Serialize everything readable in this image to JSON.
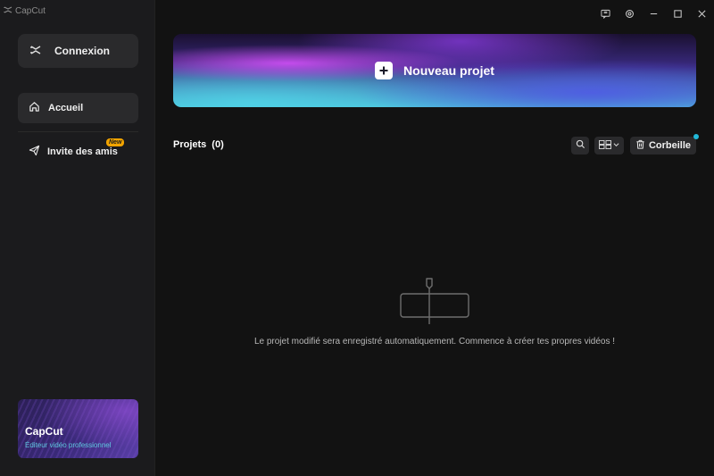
{
  "app": {
    "title": "CapCut"
  },
  "sidebar": {
    "login_label": "Connexion",
    "items": [
      {
        "label": "Accueil",
        "icon": "home-icon"
      },
      {
        "label": "Invite des amis",
        "icon": "send-icon",
        "badge": "New"
      }
    ],
    "promo": {
      "title": "CapCut",
      "subtitle": "Éditeur vidéo professionnel"
    }
  },
  "titlebar": {
    "icons": [
      "feedback-icon",
      "settings-icon",
      "minimize-icon",
      "maximize-icon",
      "close-icon"
    ]
  },
  "main": {
    "new_project_label": "Nouveau projet",
    "projects_label": "Projets",
    "projects_count": "(0)",
    "trash_label": "Corbeille",
    "empty_message": "Le projet modifié sera enregistré automatiquement. Commence à créer tes propres vidéos !"
  },
  "colors": {
    "accent": "#21b8d8",
    "badge": "#f2a400",
    "background": "#121212",
    "sidebar": "#1b1b1d"
  }
}
